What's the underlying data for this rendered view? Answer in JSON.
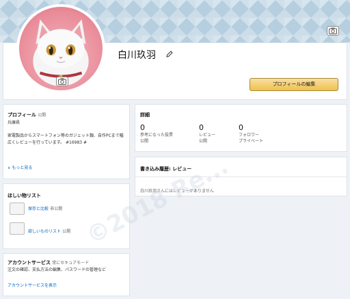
{
  "header": {
    "user_name": "白川玖羽",
    "edit_profile_label": "プロフィールの編集"
  },
  "profile": {
    "title": "プロフィール",
    "visibility": "公開",
    "location": "兵庫県",
    "bio": "家電製品からスマートフォン等のガジェット類、自作PCまで幅広くレビューを行っています。 #16983 #",
    "see_more": "もっと見る"
  },
  "details": {
    "title": "詳細",
    "stats": [
      {
        "value": "0",
        "label": "参考になった投票",
        "sub": "公開"
      },
      {
        "value": "0",
        "label": "レビュー",
        "sub": "公開"
      },
      {
        "value": "0",
        "label": "フォロワー",
        "sub": "プライベート"
      }
    ]
  },
  "activity": {
    "title": "書き込み履歴: レビュー",
    "empty_message": "白川玖羽さんにはレビューがありません"
  },
  "wishlist": {
    "title": "ほしい物リスト",
    "items": [
      {
        "label": "保存と比較",
        "visibility": "非公開"
      },
      {
        "label": "欲しいものリスト",
        "visibility": "公開"
      }
    ]
  },
  "account": {
    "title": "アカウントサービス",
    "tagline": "常にセキュアモード",
    "description": "注文の確認、支払方法の編集、パスワードの管理など",
    "link": "アカウントサービスを表示"
  },
  "watermark": "©2018 Re..."
}
